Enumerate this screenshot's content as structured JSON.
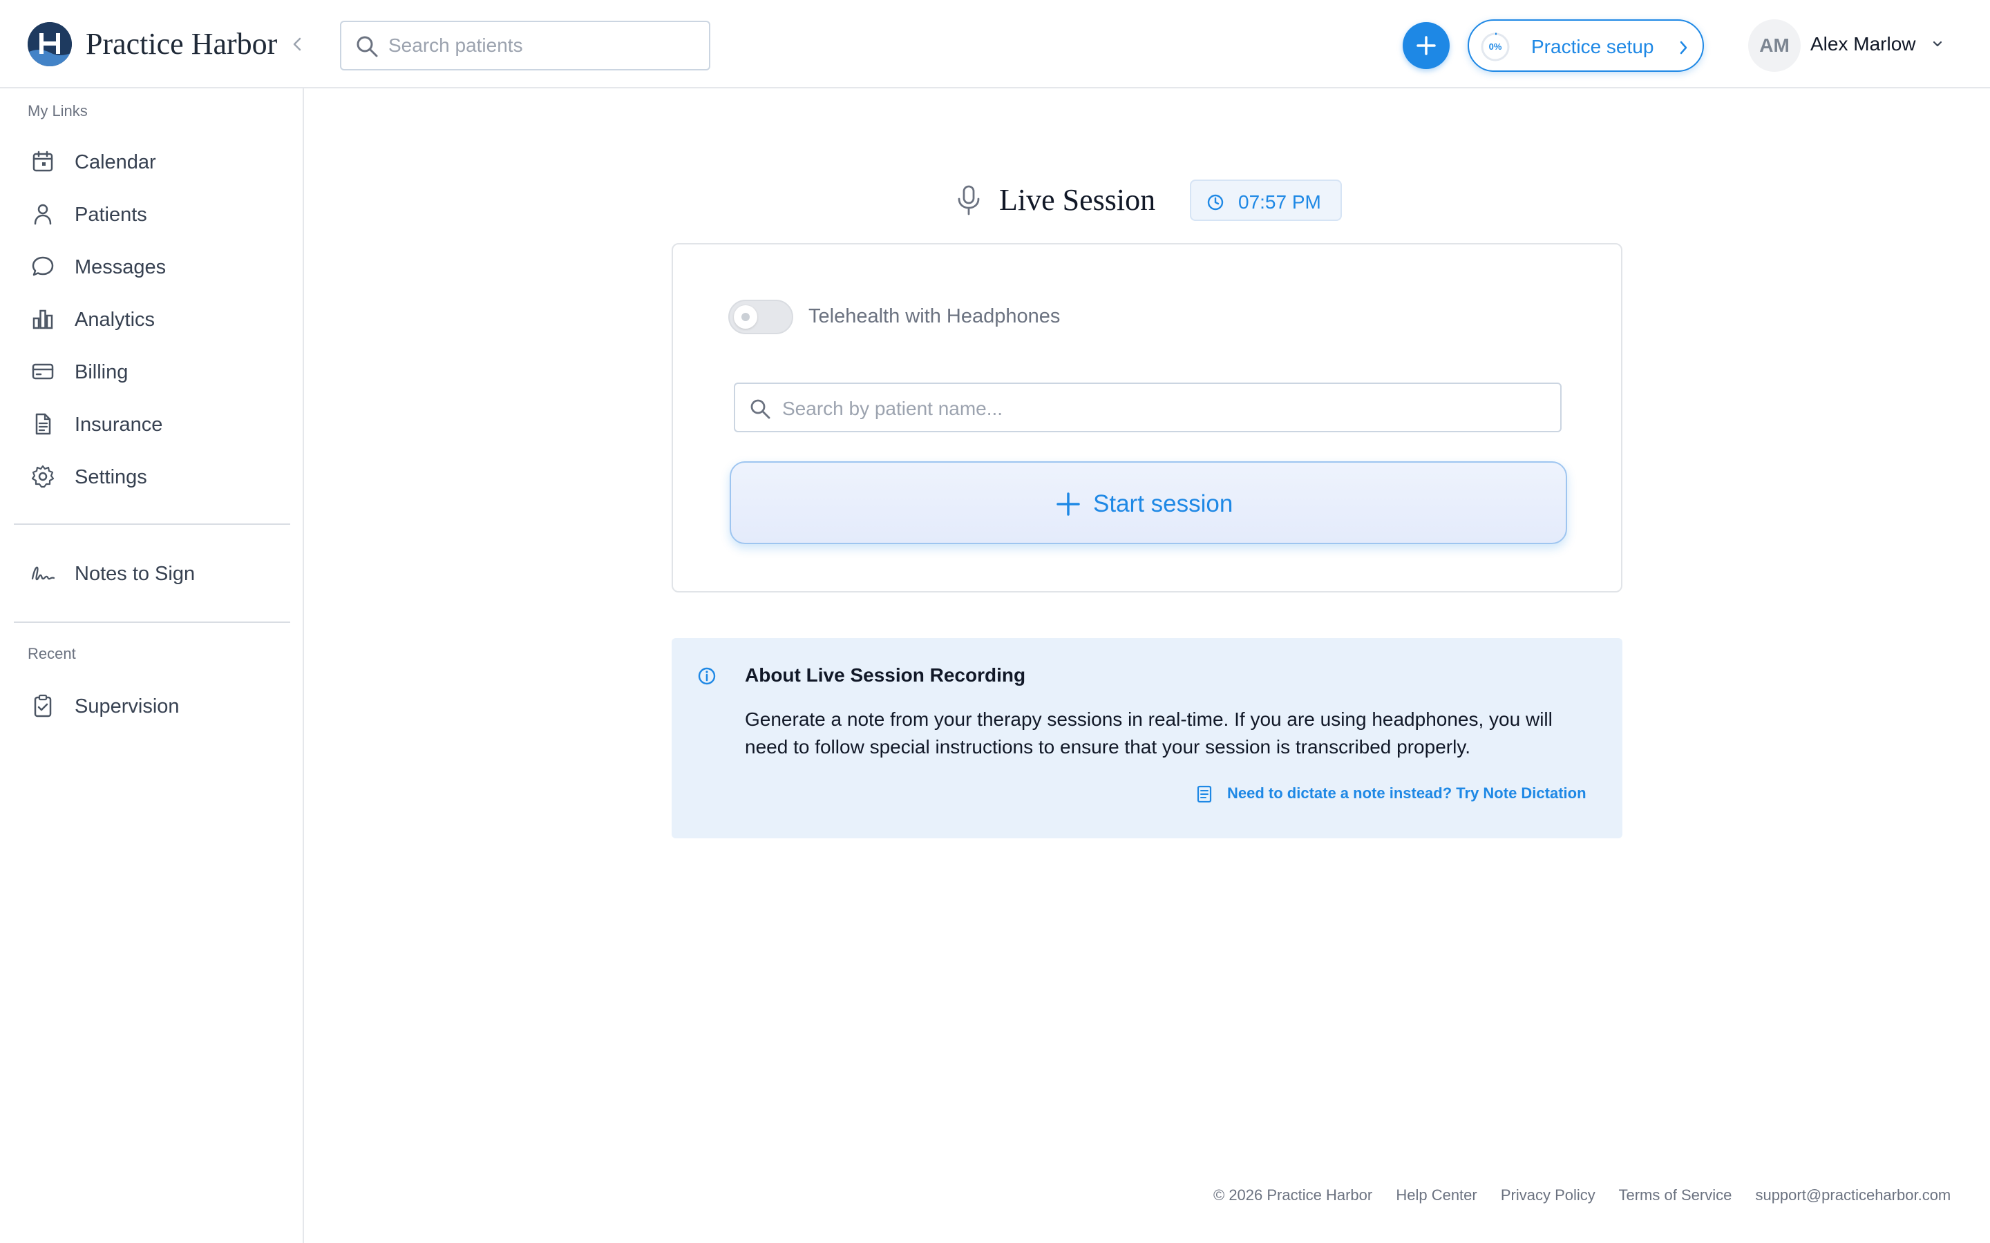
{
  "header": {
    "brand": "Practice Harbor",
    "search_placeholder": "Search patients",
    "setup_percent": "0%",
    "setup_label": "Practice setup",
    "avatar_initials": "AM",
    "user_name": "Alex Marlow"
  },
  "sidebar": {
    "my_links_heading": "My Links",
    "items": [
      {
        "label": "Calendar",
        "icon": "calendar-icon"
      },
      {
        "label": "Patients",
        "icon": "user-icon"
      },
      {
        "label": "Messages",
        "icon": "chat-icon"
      },
      {
        "label": "Analytics",
        "icon": "bar-chart-icon"
      },
      {
        "label": "Billing",
        "icon": "credit-card-icon"
      },
      {
        "label": "Insurance",
        "icon": "document-icon"
      },
      {
        "label": "Settings",
        "icon": "gear-icon"
      }
    ],
    "notes_to_sign": {
      "label": "Notes to Sign",
      "icon": "signature-icon"
    },
    "recent_heading": "Recent",
    "recent_items": [
      {
        "label": "Supervision",
        "icon": "clipboard-check-icon"
      }
    ]
  },
  "main": {
    "title": "Live Session",
    "time": "07:57 PM",
    "toggle_label": "Telehealth with Headphones",
    "toggle_on": false,
    "patient_search_placeholder": "Search by patient name...",
    "start_label": "Start session",
    "info": {
      "title": "About Live Session Recording",
      "body": "Generate a note from your therapy sessions in real-time. If you are using headphones, you will need to follow special instructions to ensure that your session is transcribed properly.",
      "link": "Need to dictate a note instead? Try Note Dictation"
    }
  },
  "footer": {
    "copyright": "© 2026 Practice Harbor",
    "help": "Help Center",
    "privacy": "Privacy Policy",
    "terms": "Terms of Service",
    "email": "support@practiceharbor.com"
  },
  "colors": {
    "accent": "#1e88e5",
    "info_bg": "#e8f1fb",
    "brand_navy": "#1e3a5f"
  }
}
